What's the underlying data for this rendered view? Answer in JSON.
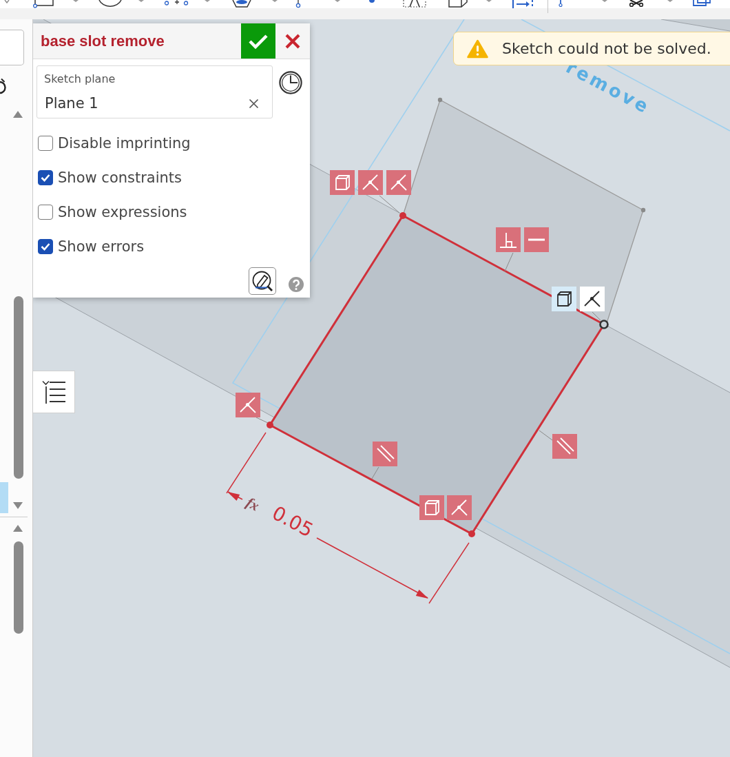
{
  "feature_dialog": {
    "title": "base slot remove",
    "error": true,
    "sketch_plane": {
      "label": "Sketch plane",
      "value": "Plane 1"
    },
    "options": [
      {
        "label": "Disable imprinting",
        "checked": false
      },
      {
        "label": "Show constraints",
        "checked": true
      },
      {
        "label": "Show expressions",
        "checked": false
      },
      {
        "label": "Show errors",
        "checked": true
      }
    ]
  },
  "notification": {
    "kind": "warning",
    "message": "Sketch could not be solved."
  },
  "sketch": {
    "plane_label": "remove",
    "dimension": {
      "expression_mark": "fx",
      "value": "0.05",
      "error": true
    },
    "constraints": [
      {
        "kind": "cube",
        "error": true,
        "highlighted": false
      },
      {
        "kind": "coincident",
        "error": true,
        "highlighted": false
      },
      {
        "kind": "coincident",
        "error": true,
        "highlighted": false
      },
      {
        "kind": "perpendicular",
        "error": true,
        "highlighted": false
      },
      {
        "kind": "horizontal",
        "error": true,
        "highlighted": false
      },
      {
        "kind": "cube",
        "error": false,
        "highlighted": true
      },
      {
        "kind": "coincident",
        "error": false,
        "highlighted": false
      },
      {
        "kind": "coincident",
        "error": true,
        "highlighted": false
      },
      {
        "kind": "parallel",
        "error": true,
        "highlighted": false
      },
      {
        "kind": "parallel",
        "error": true,
        "highlighted": false
      },
      {
        "kind": "cube",
        "error": true,
        "highlighted": false
      },
      {
        "kind": "coincident",
        "error": true,
        "highlighted": false
      }
    ]
  }
}
